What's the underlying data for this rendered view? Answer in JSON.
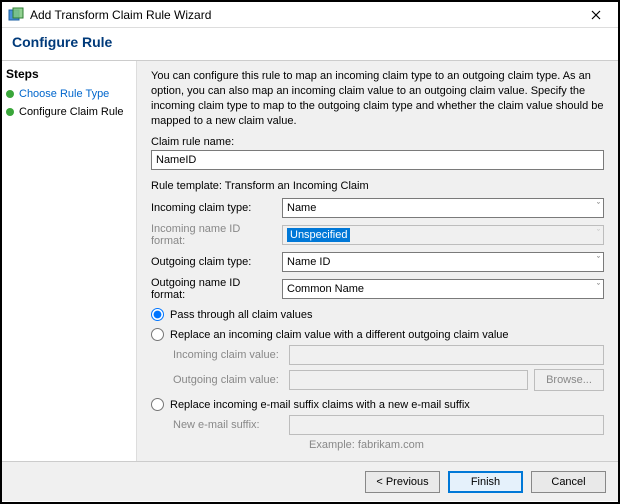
{
  "window": {
    "title": "Add Transform Claim Rule Wizard",
    "subtitle": "Configure Rule"
  },
  "steps": {
    "header": "Steps",
    "items": [
      {
        "label": "Choose Rule Type",
        "type": "link"
      },
      {
        "label": "Configure Claim Rule",
        "type": "current"
      }
    ]
  },
  "main": {
    "description": "You can configure this rule to map an incoming claim type to an outgoing claim type. As an option, you can also map an incoming claim value to an outgoing claim value. Specify the incoming claim type to map to the outgoing claim type and whether the claim value should be mapped to a new claim value.",
    "claim_rule_name_label": "Claim rule name:",
    "claim_rule_name_value": "NameID",
    "rule_template_label": "Rule template: Transform an Incoming Claim",
    "incoming_type_label": "Incoming claim type:",
    "incoming_type_value": "Name",
    "incoming_nameid_label": "Incoming name ID format:",
    "incoming_nameid_value": "Unspecified",
    "outgoing_type_label": "Outgoing claim type:",
    "outgoing_type_value": "Name ID",
    "outgoing_nameid_label": "Outgoing name ID format:",
    "outgoing_nameid_value": "Common Name",
    "radio_passthrough": "Pass through all claim values",
    "radio_replace_value": "Replace an incoming claim value with a different outgoing claim value",
    "incoming_claim_value_label": "Incoming claim value:",
    "outgoing_claim_value_label": "Outgoing claim value:",
    "browse_label": "Browse...",
    "radio_replace_suffix": "Replace incoming e-mail suffix claims with a new e-mail suffix",
    "new_email_suffix_label": "New e-mail suffix:",
    "example_label": "Example: fabrikam.com"
  },
  "footer": {
    "previous": "< Previous",
    "finish": "Finish",
    "cancel": "Cancel"
  }
}
